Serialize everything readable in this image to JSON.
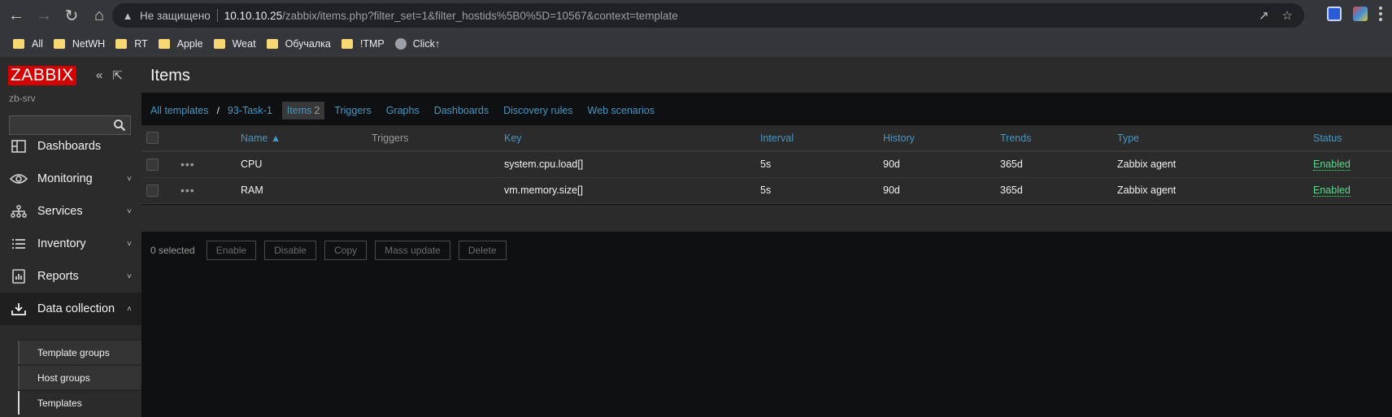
{
  "browser": {
    "not_secure": "Не защищено",
    "url_host": "10.10.10.25",
    "url_path": "/zabbix/items.php?filter_set=1&filter_hostids%5B0%5D=10567&context=template",
    "bookmarks": [
      {
        "label": "All",
        "icon": "folder-icon"
      },
      {
        "label": "NetWH",
        "icon": "folder-icon"
      },
      {
        "label": "RT",
        "icon": "folder-icon"
      },
      {
        "label": "Apple",
        "icon": "folder-icon"
      },
      {
        "label": "Weat",
        "icon": "folder-icon"
      },
      {
        "label": "Обучалка",
        "icon": "folder-icon"
      },
      {
        "label": "!TMP",
        "icon": "folder-icon"
      },
      {
        "label": "Click↑",
        "icon": "globe-icon"
      }
    ]
  },
  "sidebar": {
    "logo": "ZABBIX",
    "server": "zb-srv",
    "search_placeholder": "",
    "menu": [
      {
        "label": "Dashboards",
        "icon": "dashboard-icon"
      },
      {
        "label": "Monitoring",
        "icon": "eye-icon"
      },
      {
        "label": "Services",
        "icon": "services-icon"
      },
      {
        "label": "Inventory",
        "icon": "list-icon"
      },
      {
        "label": "Reports",
        "icon": "report-icon"
      },
      {
        "label": "Data collection",
        "icon": "download-icon"
      }
    ],
    "submenu": [
      {
        "label": "Template groups"
      },
      {
        "label": "Host groups"
      },
      {
        "label": "Templates"
      }
    ]
  },
  "page": {
    "title": "Items",
    "breadcrumb_all": "All templates",
    "breadcrumb_template": "93-Task-1",
    "tab_items": "Items",
    "tab_items_count": "2",
    "tabs": [
      "Triggers",
      "Graphs",
      "Dashboards",
      "Discovery rules",
      "Web scenarios"
    ]
  },
  "table": {
    "columns": {
      "name": "Name ▲",
      "triggers": "Triggers",
      "key": "Key",
      "interval": "Interval",
      "history": "History",
      "trends": "Trends",
      "type": "Type",
      "status": "Status"
    },
    "rows": [
      {
        "name": "CPU",
        "key": "system.cpu.load[]",
        "interval": "5s",
        "history": "90d",
        "trends": "365d",
        "type": "Zabbix agent",
        "status": "Enabled"
      },
      {
        "name": "RAM",
        "key": "vm.memory.size[]",
        "interval": "5s",
        "history": "90d",
        "trends": "365d",
        "type": "Zabbix agent",
        "status": "Enabled"
      }
    ]
  },
  "actions": {
    "selected": "0 selected",
    "enable": "Enable",
    "disable": "Disable",
    "copy": "Copy",
    "mass_update": "Mass update",
    "delete": "Delete"
  }
}
